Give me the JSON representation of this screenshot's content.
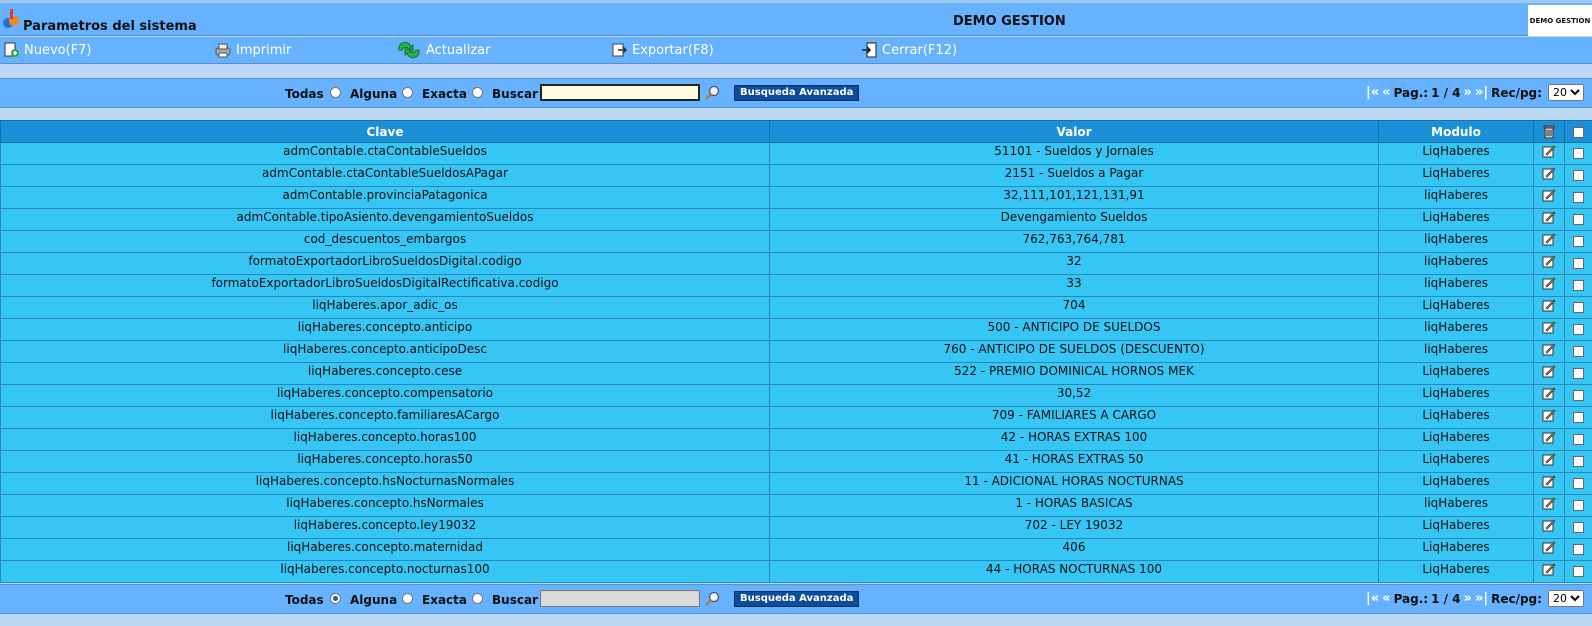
{
  "app": {
    "window_title": "Parametros del sistema",
    "company": "DEMO GESTION",
    "logo_text": "DEMO GESTION"
  },
  "toolbar": {
    "buttons": [
      {
        "label": "Nuevo(F7)",
        "icon": "new-doc-icon"
      },
      {
        "label": "Imprimir",
        "icon": "printer-icon"
      },
      {
        "label": "Actualizar",
        "icon": "refresh-icon"
      },
      {
        "label": "Exportar(F8)",
        "icon": "export-icon"
      },
      {
        "label": "Cerrar(F12)",
        "icon": "exit-icon"
      }
    ]
  },
  "search_top": {
    "options": [
      "Todas",
      "Alguna",
      "Exacta",
      "Buscar"
    ],
    "selected": "",
    "value": "",
    "advanced_label": "Busqueda Avanzada"
  },
  "search_bottom": {
    "options": [
      "Todas",
      "Alguna",
      "Exacta",
      "Buscar"
    ],
    "selected": "Todas",
    "value": "",
    "advanced_label": "Busqueda Avanzada"
  },
  "pager": {
    "first": "|«",
    "prev": "«",
    "page_label": "Pag.:",
    "page_value": "1 / 4",
    "next": "»",
    "last": "»|",
    "recpg_label": "Rec/pg:",
    "recpg_value": "20"
  },
  "table": {
    "columns": [
      "Clave",
      "Valor",
      "Modulo"
    ],
    "rows": [
      [
        "admContable.ctaContableSueldos",
        "51101 - Sueldos y Jornales",
        "LiqHaberes"
      ],
      [
        "admContable.ctaContableSueldosAPagar",
        "2151 - Sueldos a Pagar",
        "LiqHaberes"
      ],
      [
        "admContable.provinciaPatagonica",
        "32,111,101,121,131,91",
        "liqHaberes"
      ],
      [
        "admContable.tipoAsiento.devengamientoSueldos",
        "Devengamiento Sueldos",
        "LiqHaberes"
      ],
      [
        "cod_descuentos_embargos",
        "762,763,764,781",
        "liqHaberes"
      ],
      [
        "formatoExportadorLibroSueldosDigital.codigo",
        "32",
        "liqHaberes"
      ],
      [
        "formatoExportadorLibroSueldosDigitalRectificativa.codigo",
        "33",
        "liqHaberes"
      ],
      [
        "liqHaberes.apor_adic_os",
        "704",
        "LiqHaberes"
      ],
      [
        "liqHaberes.concepto.anticipo",
        "500 - ANTICIPO DE SUELDOS",
        "liqHaberes"
      ],
      [
        "liqHaberes.concepto.anticipoDesc",
        "760 - ANTICIPO DE SUELDOS (DESCUENTO)",
        "liqHaberes"
      ],
      [
        "liqHaberes.concepto.cese",
        "522 - PREMIO DOMINICAL HORNOS MEK",
        "LiqHaberes"
      ],
      [
        "liqHaberes.concepto.compensatorio",
        "30,52",
        "LiqHaberes"
      ],
      [
        "liqHaberes.concepto.familiaresACargo",
        "709 - FAMILIARES A CARGO",
        "LiqHaberes"
      ],
      [
        "liqHaberes.concepto.horas100",
        "42 - HORAS EXTRAS 100",
        "LiqHaberes"
      ],
      [
        "liqHaberes.concepto.horas50",
        "41 - HORAS EXTRAS 50",
        "LiqHaberes"
      ],
      [
        "liqHaberes.concepto.hsNocturnasNormales",
        "11 - ADICIONAL HORAS NOCTURNAS",
        "LiqHaberes"
      ],
      [
        "liqHaberes.concepto.hsNormales",
        "1 - HORAS BASICAS",
        "liqHaberes"
      ],
      [
        "liqHaberes.concepto.ley19032",
        "702 - LEY 19032",
        "LiqHaberes"
      ],
      [
        "liqHaberes.concepto.maternidad",
        "406",
        "LiqHaberes"
      ],
      [
        "liqHaberes.concepto.nocturnas100",
        "44 - HORAS NOCTURNAS 100",
        "LiqHaberes"
      ]
    ]
  },
  "colors": {
    "header_bar": "#66b2ff",
    "grid_header": "#1c90d6",
    "grid_row": "#35c6f5",
    "advanced_button": "#0e4c9a"
  }
}
